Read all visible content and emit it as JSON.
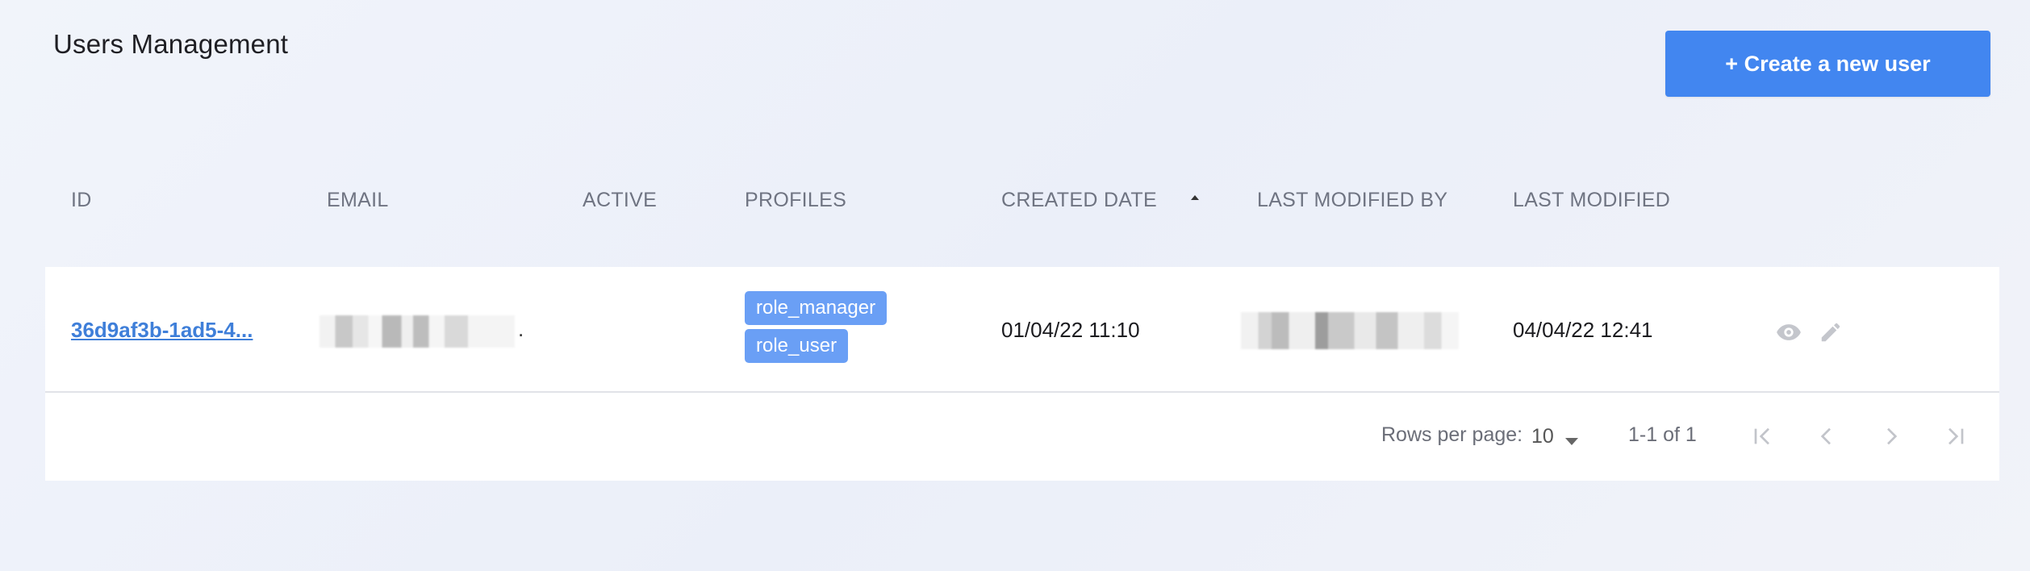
{
  "page": {
    "title": "Users Management",
    "create_button": "+ Create a new user"
  },
  "table": {
    "columns": [
      "ID",
      "EMAIL",
      "ACTIVE",
      "PROFILES",
      "CREATED DATE",
      "LAST MODIFIED BY",
      "LAST MODIFIED"
    ],
    "sorted_column": "CREATED DATE",
    "sort_direction": "ascending",
    "rows": [
      {
        "id": "36d9af3b-1ad5-4...",
        "email_suffix": ".",
        "active": "",
        "profiles": [
          "role_manager",
          "role_user"
        ],
        "created_date": "01/04/22 11:10",
        "last_modified": "04/04/22 12:41"
      }
    ]
  },
  "pagination": {
    "rows_per_page_label": "Rows per page:",
    "rows_per_page_value": "10",
    "range": "1-1 of 1"
  },
  "icons": {
    "view": "eye-icon",
    "edit": "pencil-icon",
    "first": "first-page-icon",
    "prev": "chevron-left-icon",
    "next": "chevron-right-icon",
    "last": "last-page-icon",
    "sort": "sort-up-icon",
    "dropdown": "caret-down-icon"
  },
  "colors": {
    "primary": "#4286f0",
    "badge": "#6a9ff5",
    "link": "#3f7fd9",
    "header_text": "#6f7482"
  }
}
